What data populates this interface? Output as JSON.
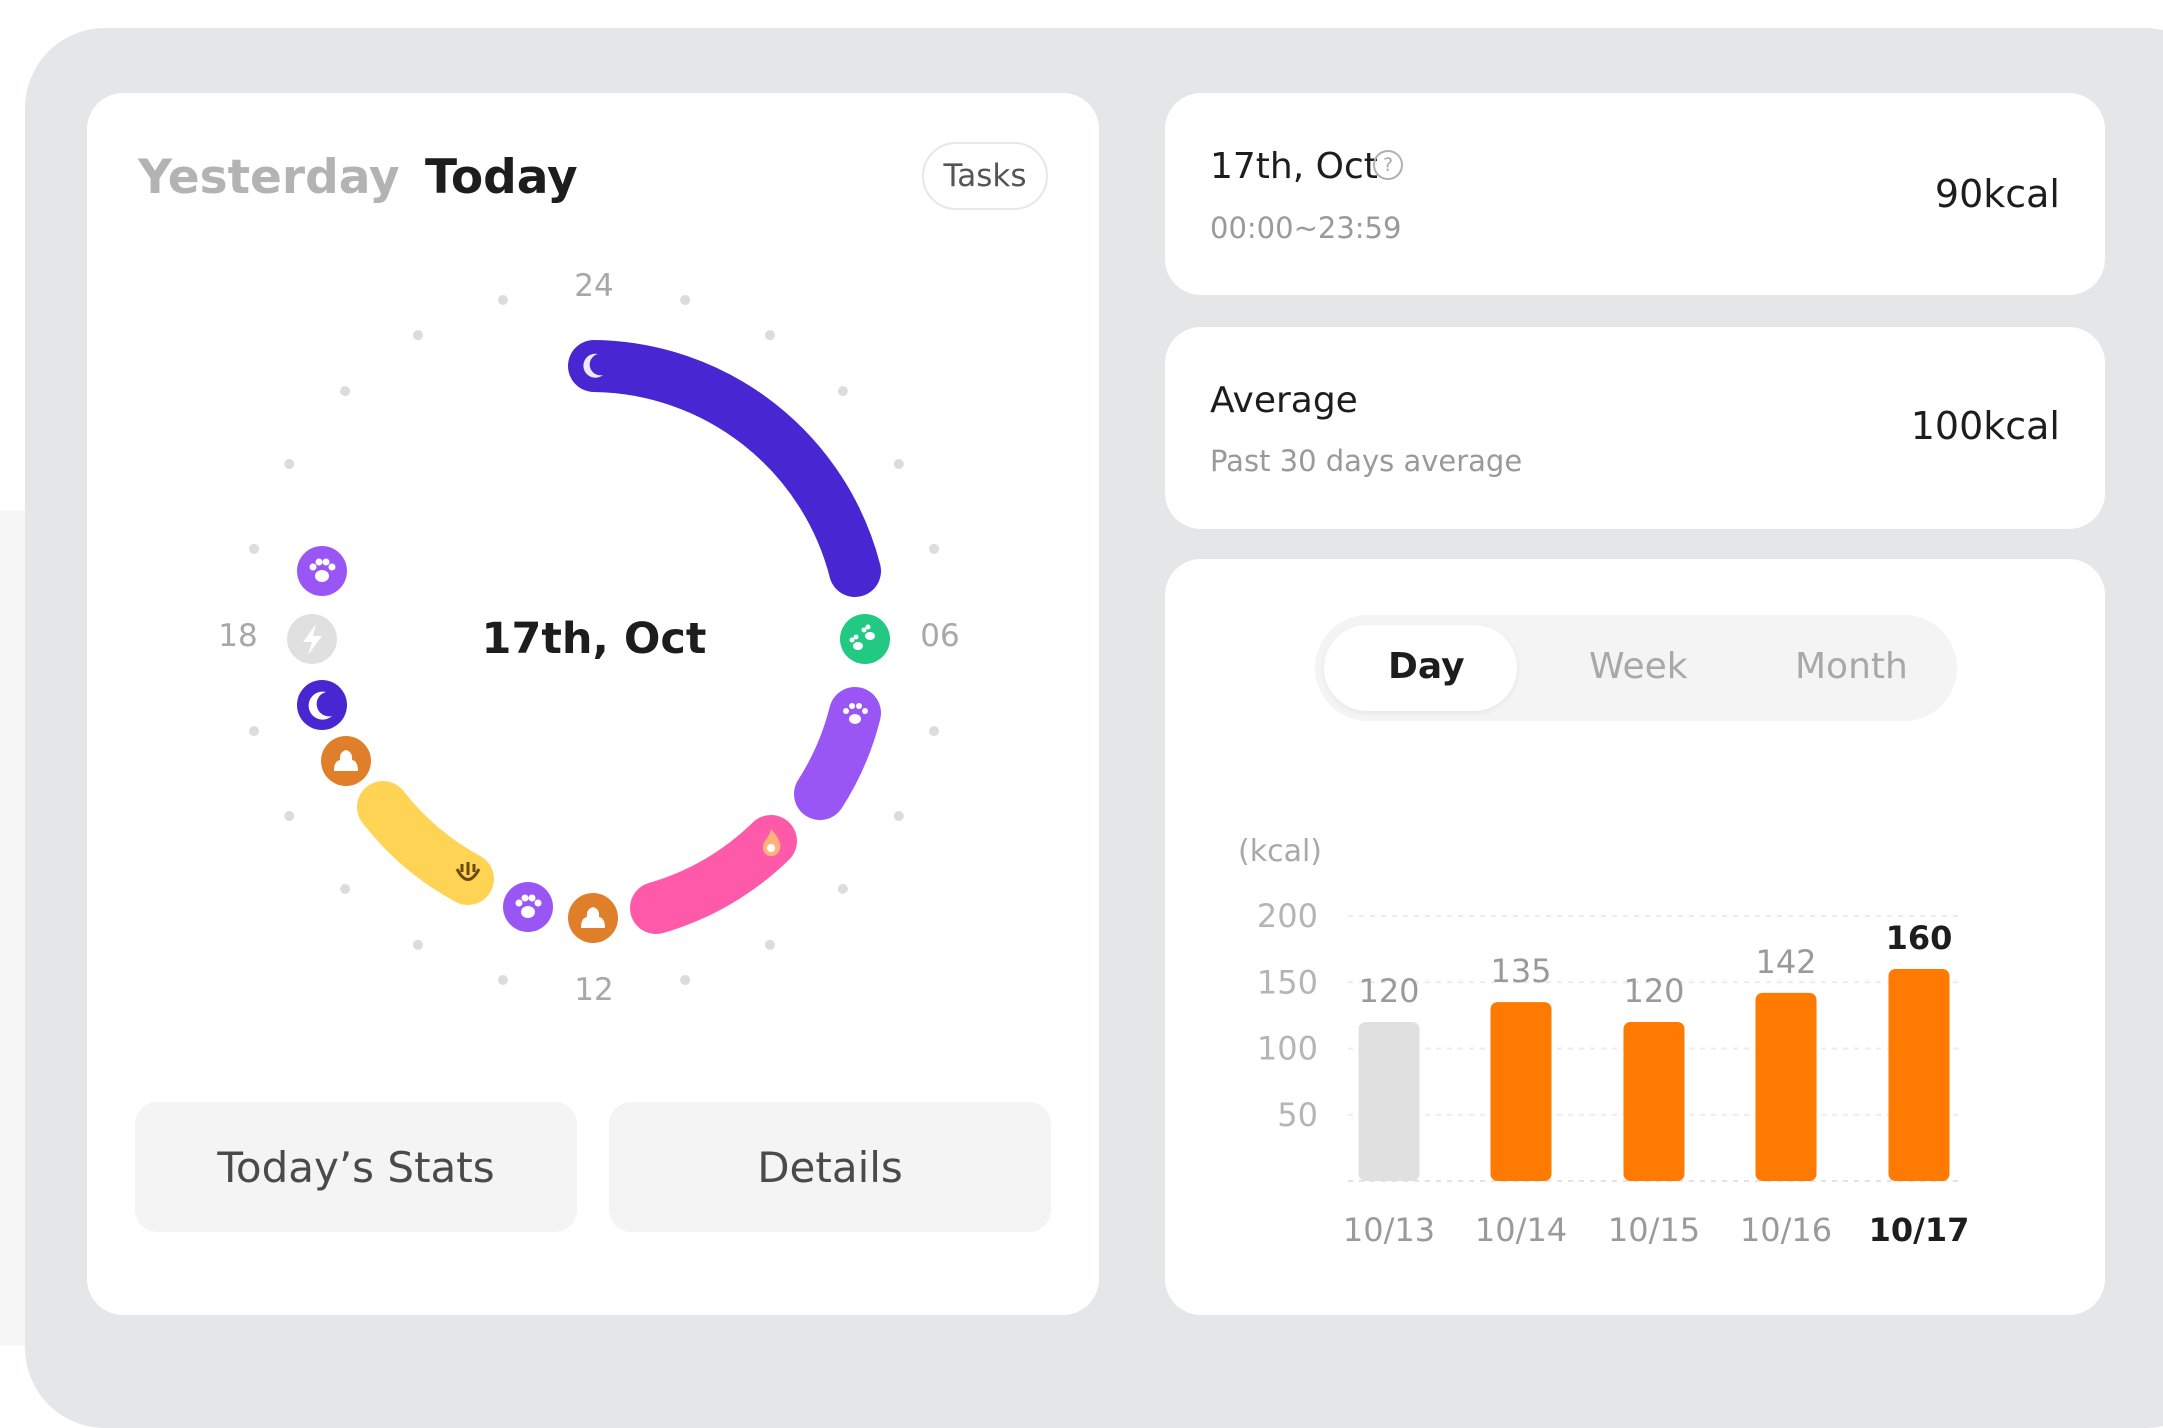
{
  "header": {
    "tab_yesterday": "Yesterday",
    "tab_today": "Today",
    "tasks_label": "Tasks"
  },
  "dial": {
    "center_label": "17th, Oct",
    "hour_labels": {
      "top": "24",
      "right": "06",
      "bottom": "12",
      "left": "18"
    }
  },
  "buttons": {
    "stats": "Today’s Stats",
    "details": "Details"
  },
  "summary": {
    "date": "17th, Oct",
    "time_range": "00:00~23:59",
    "value": "90kcal",
    "help_glyph": "?"
  },
  "average": {
    "title": "Average",
    "subtitle": "Past 30 days average",
    "value": "100kcal"
  },
  "period_tabs": {
    "day": "Day",
    "week": "Week",
    "month": "Month",
    "selected": "Day"
  },
  "colors": {
    "sleep": "#4826d2",
    "play": "#9a56f4",
    "walk": "#22c982",
    "burn": "#ff5aa9",
    "meal": "#ffd454",
    "poop": "#e07f2a",
    "bar_active": "#ff7a00",
    "bar_inactive": "#e0e0e0"
  },
  "chart_data": {
    "type": "bar",
    "ylabel": "(kcal)",
    "yticks": [
      50,
      100,
      150,
      200
    ],
    "ylim": [
      0,
      200
    ],
    "grid": true,
    "categories": [
      "10/13",
      "10/14",
      "10/15",
      "10/16",
      "10/17"
    ],
    "values": [
      120,
      135,
      120,
      142,
      160
    ],
    "highlight": "10/17"
  }
}
